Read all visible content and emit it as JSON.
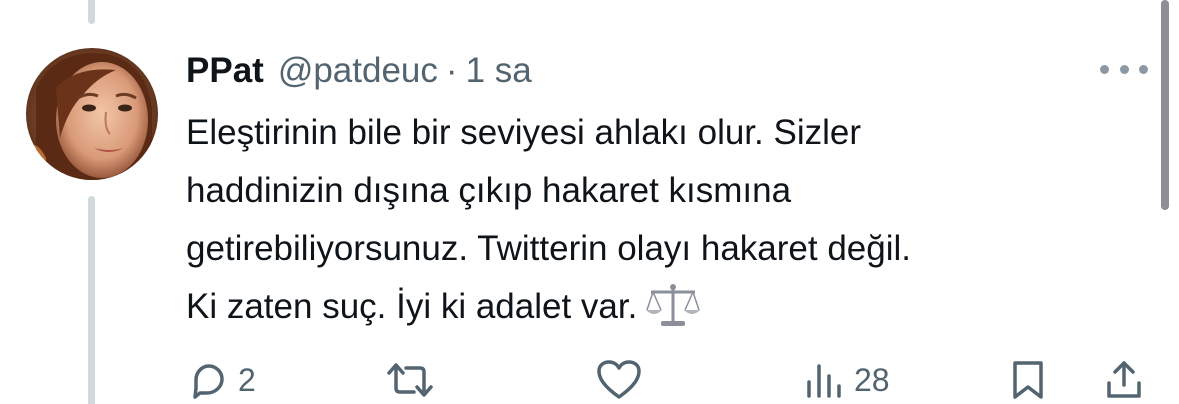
{
  "tweet": {
    "display_name": "PPat",
    "handle": "@patdeuc",
    "separator": "·",
    "time": "1 sa",
    "text_lines": [
      "Eleştirinin bile bir seviyesi ahlakı olur. Sizler",
      "haddinizin dışına çıkıp hakaret kısmına",
      "getirebiliyorsunuz. Twitterin olayı hakaret değil.",
      "Ki zaten suç. İyi ki adalet var."
    ],
    "emoji": "scales-emoji"
  },
  "actions": {
    "reply": {
      "icon": "reply-icon",
      "count": "2"
    },
    "retweet": {
      "icon": "retweet-icon"
    },
    "like": {
      "icon": "heart-icon"
    },
    "views": {
      "icon": "views-icon",
      "count": "28"
    },
    "bookmark": {
      "icon": "bookmark-icon"
    },
    "share": {
      "icon": "share-icon"
    }
  },
  "colors": {
    "text": "#0f1419",
    "secondary": "#536471",
    "thread_line": "#cfd9de"
  }
}
